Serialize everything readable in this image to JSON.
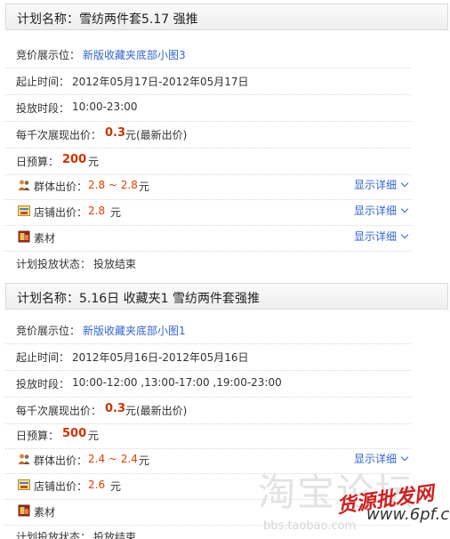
{
  "plans": [
    {
      "title": "计划名称：雪纺两件套5.17 强推",
      "position_label": "竞价展示位：",
      "position_value": "新版收藏夹底部小图3",
      "period_label": "起止时间：",
      "period_value": "2012年05月17日-2012年05月17日",
      "slot_label": "投放时段：",
      "slot_value": "10:00-23:00",
      "cpm_label": "每千次展现出价：",
      "cpm_value": "0.3",
      "cpm_suffix": "元(最新出价)",
      "budget_label": "日预算：",
      "budget_value": "200",
      "budget_unit": "元",
      "group_label": "群体出价：",
      "group_value": "2.8 ~ 2.8",
      "group_unit": "元",
      "shop_label": "店铺出价：",
      "shop_value": "2.8",
      "shop_unit": "元",
      "material_label": "素材",
      "show_detail": "显示详细",
      "status_label": "计划投放状态：",
      "status_value": "投放结束"
    },
    {
      "title": "计划名称：5.16日 收藏夹1 雪纺两件套强推",
      "position_label": "竞价展示位：",
      "position_value": "新版收藏夹底部小图1",
      "period_label": "起止时间：",
      "period_value": "2012年05月16日-2012年05月16日",
      "slot_label": "投放时段：",
      "slot_value": "10:00-12:00 ,13:00-17:00 ,19:00-23:00",
      "cpm_label": "每千次展现出价：",
      "cpm_value": "0.3",
      "cpm_suffix": "元(最新出价)",
      "budget_label": "日预算：",
      "budget_value": "500",
      "budget_unit": "元",
      "group_label": "群体出价：",
      "group_value": "2.4 ~ 2.4",
      "group_unit": "元",
      "shop_label": "店铺出价：",
      "shop_value": "2.6",
      "shop_unit": "元",
      "material_label": "素材",
      "show_detail": "显示详细",
      "status_label": "计划投放状态：",
      "status_value": "投放结束"
    }
  ],
  "watermark": {
    "logo": "淘宝论坛",
    "url": "bbs.taobao.com",
    "site_cn": "货源批发网",
    "site_url": "www.6pf.cn"
  },
  "colors": {
    "link": "#3366cc",
    "price": "#cc3300",
    "orange": "#e04000"
  }
}
